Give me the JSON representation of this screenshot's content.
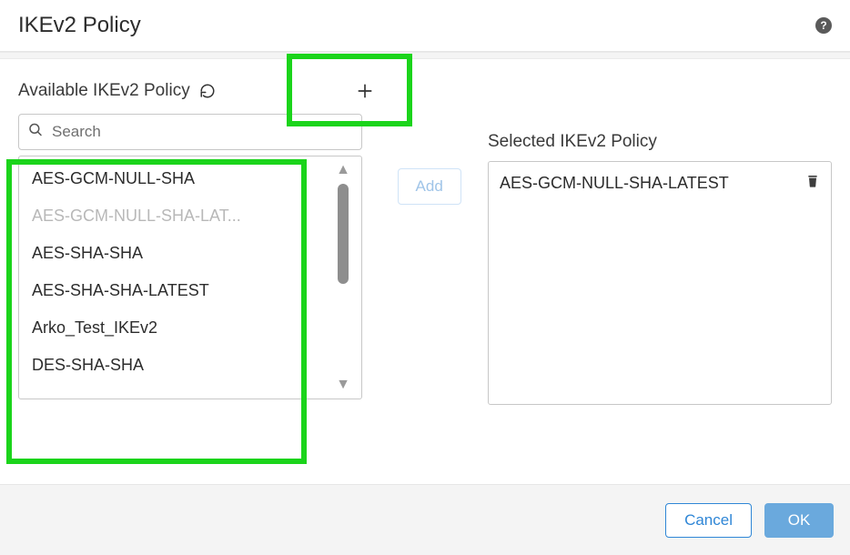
{
  "header": {
    "title": "IKEv2 Policy"
  },
  "available": {
    "title": "Available IKEv2 Policy",
    "search_placeholder": "Search",
    "items": [
      {
        "label": "AES-GCM-NULL-SHA",
        "disabled": false
      },
      {
        "label": "AES-GCM-NULL-SHA-LAT...",
        "disabled": true
      },
      {
        "label": "AES-SHA-SHA",
        "disabled": false
      },
      {
        "label": "AES-SHA-SHA-LATEST",
        "disabled": false
      },
      {
        "label": "Arko_Test_IKEv2",
        "disabled": false
      },
      {
        "label": "DES-SHA-SHA",
        "disabled": false
      }
    ]
  },
  "actions": {
    "add_label": "Add"
  },
  "selected": {
    "title": "Selected IKEv2 Policy",
    "items": [
      {
        "label": "AES-GCM-NULL-SHA-LATEST"
      }
    ]
  },
  "footer": {
    "cancel_label": "Cancel",
    "ok_label": "OK"
  }
}
